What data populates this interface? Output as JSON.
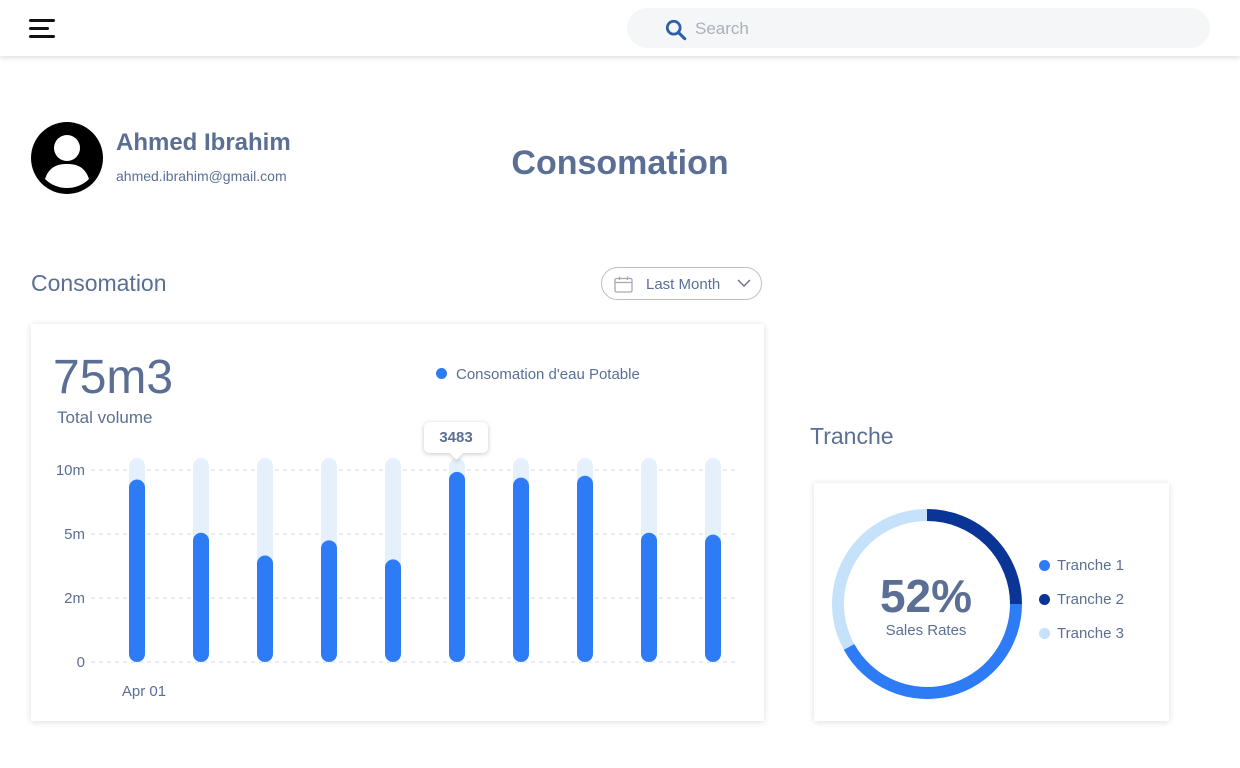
{
  "header": {
    "search": {
      "placeholder": "Search",
      "value": ""
    }
  },
  "profile": {
    "name": "Ahmed Ibrahim",
    "email": "ahmed.ibrahim@gmail.com"
  },
  "page": {
    "title": "Consomation"
  },
  "consumption": {
    "section_title": "Consomation",
    "period_select": "Last Month",
    "total_value": "75m3",
    "total_caption": "Total volume",
    "tooltip": "3483"
  },
  "tranche": {
    "section_title": "Tranche",
    "center_value": "52%",
    "center_caption": "Sales Rates"
  },
  "colors": {
    "accent": "#2e7bf6",
    "dark_blue": "#0a3596",
    "light_blue": "#c6e2fb",
    "track": "#e4f1fc",
    "text": "#5b6f95"
  },
  "chart_data": [
    {
      "type": "bar",
      "series": [
        {
          "name": "Consomation d'eau Potable",
          "values": [
            9.6,
            6.8,
            5.6,
            6.4,
            5.4,
            10.0,
            9.7,
            9.8,
            6.8,
            6.7
          ],
          "max": 10.1
        }
      ],
      "x_tick_labels": [
        "Apr 01"
      ],
      "y_ticks": [
        "0",
        "2m",
        "5m",
        "10m"
      ],
      "grid": true,
      "legend": "top-right",
      "annotations": [
        "3483"
      ]
    },
    {
      "type": "pie",
      "style": "donut",
      "series": [
        {
          "name": "Tranche 1",
          "values": [
            0.42
          ]
        },
        {
          "name": "Tranche 2",
          "values": [
            0.25
          ]
        },
        {
          "name": "Tranche 3",
          "values": [
            0.33
          ]
        }
      ],
      "center_label": "52%",
      "legend": "right"
    }
  ]
}
